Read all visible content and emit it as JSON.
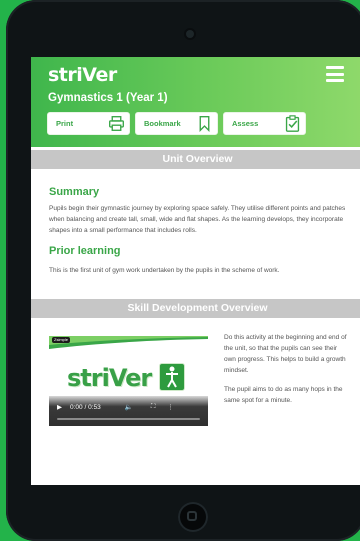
{
  "app": {
    "logo": "striVer"
  },
  "header": {
    "title": "Gymnastics 1 (Year 1)",
    "actions": [
      {
        "label": "Print",
        "icon": "printer-icon"
      },
      {
        "label": "Bookmark",
        "icon": "bookmark-icon"
      },
      {
        "label": "Assess",
        "icon": "clipboard-check-icon"
      }
    ]
  },
  "sections": {
    "unit_overview": "Unit Overview",
    "skill_overview": "Skill Development Overview"
  },
  "summary": {
    "heading": "Summary",
    "text": "Pupils begin their gymnastic journey by exploring space safely. They utilise different points and patches when balancing and create tall, small, wide and flat shapes. As the learning develops, they incorporate shapes into a small performance that includes rolls."
  },
  "prior": {
    "heading": "Prior learning",
    "text": "This is the first unit of gym work undertaken by the pupils in the scheme of work."
  },
  "video": {
    "tag": "Zsimple",
    "logo": "striVer",
    "time": "0:00 / 0:53"
  },
  "side": {
    "p1": "Do this activity at the beginning and end of the unit, so that the pupils can see their own progress. This helps to build a growth mindset.",
    "p2": "The pupil aims to do as many hops in the same spot for a minute."
  },
  "colors": {
    "brand": "#3aa648",
    "section_bar": "#c6c6c6",
    "background": "#23b34a"
  }
}
